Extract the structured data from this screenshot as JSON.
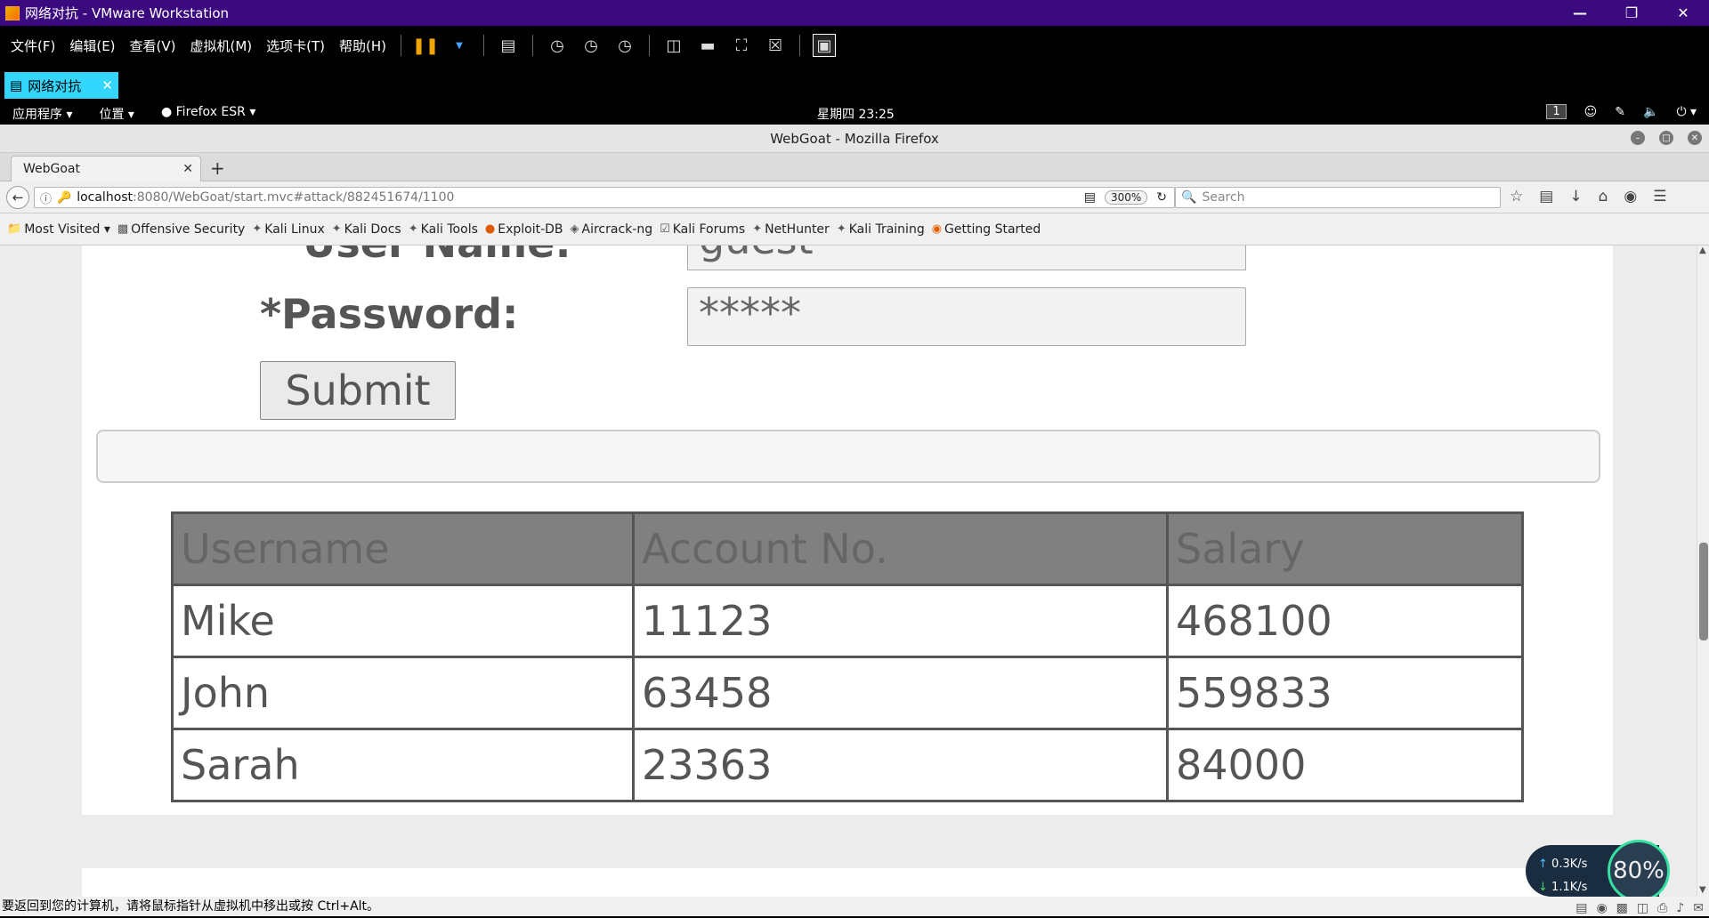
{
  "vmware": {
    "title": "网络对抗 - VMware Workstation",
    "menu": [
      "文件(F)",
      "编辑(E)",
      "查看(V)",
      "虚拟机(M)",
      "选项卡(T)",
      "帮助(H)"
    ],
    "vm_tab_label": "网络对抗",
    "status_text": "要返回到您的计算机，请将鼠标指针从虚拟机中移出或按 Ctrl+Alt。"
  },
  "gnome": {
    "applications": "应用程序 ▾",
    "places": "位置 ▾",
    "firefox": "Firefox ESR ▾",
    "clock": "星期四 23:25",
    "workspace": "1"
  },
  "firefox": {
    "window_title": "WebGoat - Mozilla Firefox",
    "tab_title": "WebGoat",
    "url_host": "localhost",
    "url_path": ":8080/WebGoat/start.mvc#attack/882451674/1100",
    "zoom": "300%",
    "search_placeholder": "Search",
    "bookmarks": [
      {
        "label": "Most Visited ▾",
        "icon": "folder-icon"
      },
      {
        "label": "Offensive Security",
        "icon": "offsec-icon"
      },
      {
        "label": "Kali Linux",
        "icon": "kali-icon"
      },
      {
        "label": "Kali Docs",
        "icon": "kali-icon"
      },
      {
        "label": "Kali Tools",
        "icon": "kali-icon"
      },
      {
        "label": "Exploit-DB",
        "icon": "exploitdb-icon"
      },
      {
        "label": "Aircrack-ng",
        "icon": "aircrack-icon"
      },
      {
        "label": "Kali Forums",
        "icon": "forum-icon"
      },
      {
        "label": "NetHunter",
        "icon": "kali-icon"
      },
      {
        "label": "Kali Training",
        "icon": "kali-icon"
      },
      {
        "label": "Getting Started",
        "icon": "firefox-icon"
      }
    ]
  },
  "form": {
    "username_label": "*User Name:",
    "username_value": "guest",
    "password_label": "*Password:",
    "password_value": "*****",
    "submit_label": "Submit"
  },
  "table": {
    "headers": [
      "Username",
      "Account No.",
      "Salary"
    ],
    "rows": [
      [
        "Mike",
        "11123",
        "468100"
      ],
      [
        "John",
        "63458",
        "559833"
      ],
      [
        "Sarah",
        "23363",
        "84000"
      ]
    ]
  },
  "network": {
    "upload": "0.3K/s",
    "download": "1.1K/s",
    "percent": "80%"
  }
}
